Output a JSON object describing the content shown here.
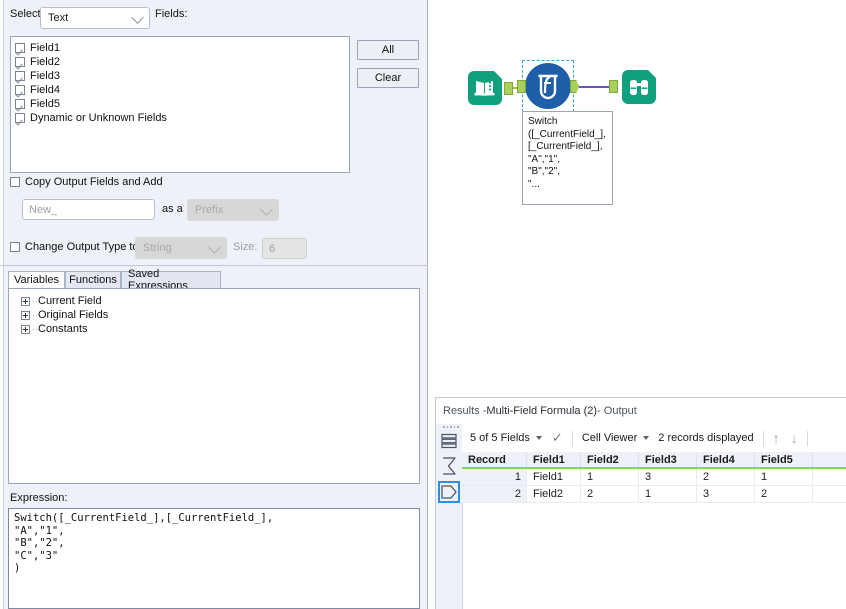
{
  "config": {
    "select_label": "Select",
    "select_value": "Text",
    "fields_label": "Fields:",
    "field_items": [
      {
        "label": "Field1",
        "checked": true
      },
      {
        "label": "Field2",
        "checked": true
      },
      {
        "label": "Field3",
        "checked": true
      },
      {
        "label": "Field4",
        "checked": true
      },
      {
        "label": "Field5",
        "checked": true
      },
      {
        "label": "Dynamic or Unknown Fields",
        "checked": true
      }
    ],
    "all_button": "All",
    "clear_button": "Clear",
    "copy_output_label": "Copy Output Fields and Add",
    "copy_output_checked": false,
    "new_field_value": "New_",
    "as_a_label": "as a",
    "prefix_value": "Prefix",
    "change_type_label": "Change Output Type to",
    "change_type_checked": false,
    "type_value": "String",
    "size_label": "Size:",
    "size_value": "6",
    "tabs": [
      {
        "label": "Variables",
        "active": true
      },
      {
        "label": "Functions",
        "active": false
      },
      {
        "label": "Saved Expressions",
        "active": false
      }
    ],
    "tree_items": [
      "Current Field",
      "Original Fields",
      "Constants"
    ],
    "expression_label": "Expression:",
    "expression_text": "Switch([_CurrentField_],[_CurrentField_],\n\"A\",\"1\",\n\"B\",\"2\",\n\"C\",\"3\"\n)"
  },
  "canvas": {
    "input_node_name": "Input Data",
    "formula_node_name": "Multi-Field Formula",
    "browse_node_name": "Browse",
    "tooltip_lines": [
      "Switch",
      "([_CurrentField_],",
      "[_CurrentField_],",
      "\"A\",\"1\",",
      "\"B\",\"2\",",
      "\"..."
    ]
  },
  "results": {
    "title_prefix": "Results - ",
    "title_tool": "Multi-Field Formula (2)",
    "title_suffix": " - Output",
    "fields_selector": "5 of 5 Fields",
    "cell_viewer": "Cell Viewer",
    "records_displayed": "2 records displayed",
    "columns": [
      "Record",
      "Field1",
      "Field2",
      "Field3",
      "Field4",
      "Field5"
    ],
    "rows": [
      {
        "record": "1",
        "cells": [
          "Field1",
          "1",
          "3",
          "2",
          "1"
        ]
      },
      {
        "record": "2",
        "cells": [
          "Field2",
          "2",
          "1",
          "3",
          "2"
        ]
      }
    ]
  },
  "colors": {
    "accent_green": "#11a07e",
    "node_blue": "#1f5fa9",
    "grid_underline": "#7ed957",
    "wire_purple": "#6a4fc4",
    "panel_bg": "#eef1f8"
  }
}
